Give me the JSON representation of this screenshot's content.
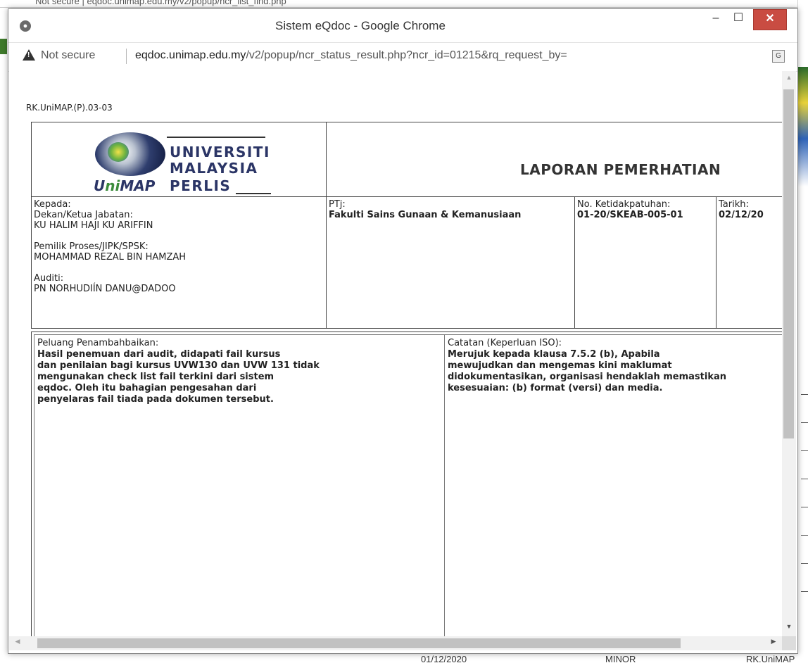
{
  "window": {
    "title": "Sistem eQdoc - Google Chrome",
    "min_glyph": "–",
    "max_glyph": "☐",
    "close_glyph": "✕"
  },
  "address_bar": {
    "security_label": "Not secure",
    "url_host": "eqdoc.unimap.edu.my",
    "url_path": "/v2/popup/ncr_status_result.php?ncr_id=01215&rq_request_by="
  },
  "document": {
    "form_code": "RK.UniMAP.(P).03-03",
    "logo": {
      "line1": "UNIVERSITI",
      "line2": "MALAYSIA",
      "line3": "PERLIS",
      "brand_prefix": "U",
      "brand_i": "ni",
      "brand_suffix": "MAP"
    },
    "report_title": "LAPORAN PEMERHATIAN",
    "kepada": {
      "label": "Kepada:",
      "dekan_label": "Dekan/Ketua Jabatan:",
      "dekan_name": "KU HALIM HAJI KU ARIFFIN",
      "pemilik_label": "Pemilik Proses/JIPK/SPSK:",
      "pemilik_name": "MOHAMMAD REZAL BIN HAMZAH",
      "auditi_label": "Auditi:",
      "auditi_name": "PN NORHUDIÍN DANU@DADOO"
    },
    "ptj": {
      "label": "PTj:",
      "value": "Fakulti Sains Gunaan & Kemanusiaan"
    },
    "ncr_no": {
      "label": "No. Ketidakpatuhan:",
      "value": "01-20/SKEAB-005-01"
    },
    "tarikh": {
      "label": "Tarikh:",
      "value": "02/12/20"
    },
    "peluang": {
      "label": "Peluang Penambahbaikan:",
      "lines": [
        "Hasil penemuan dari audit, didapati fail kursus",
        "dan penilaian bagi kursus UVW130 dan UVW 131 tidak",
        "mengunakan check list fail terkini dari sistem",
        "eqdoc. Oleh itu bahagian pengesahan dari",
        "penyelaras fail tiada pada dokumen tersebut."
      ]
    },
    "catatan": {
      "label": "Catatan (Keperluan ISO):",
      "lines": [
        "Merujuk kepada klausa 7.5.2 (b), Apabila",
        "mewujudkan dan mengemas kini maklumat",
        "didokumentasikan, organisasi hendaklah memastikan",
        "kesesuaian: (b) format (versi) dan media."
      ]
    }
  },
  "background": {
    "top_text": "Not secure | eqdoc.unimap.edu.my/v2/popup/ncr_list_find.php",
    "bottom_date": "01/12/2020",
    "bottom_status": "MINOR",
    "bottom_code": "RK.UniMAP"
  },
  "colors": {
    "close_button": "#c94c42",
    "logo_navy": "#2b3566"
  }
}
